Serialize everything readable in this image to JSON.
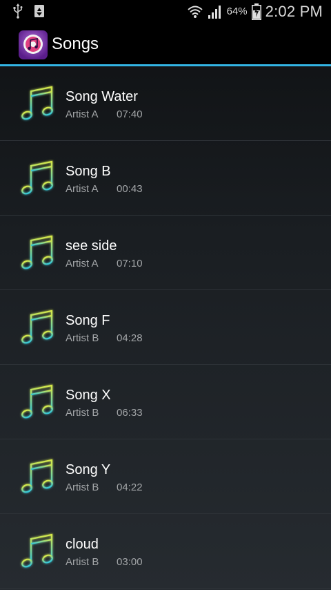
{
  "status_bar": {
    "icons_left": [
      "usb-icon",
      "recycle-icon"
    ],
    "battery_percent": "64%",
    "time": "2:02 PM"
  },
  "action_bar": {
    "title": "Songs",
    "icon": "music-app-icon"
  },
  "songs": [
    {
      "title": "Song Water",
      "artist": "Artist A",
      "duration": "07:40"
    },
    {
      "title": "Song B",
      "artist": "Artist A",
      "duration": "00:43"
    },
    {
      "title": "see side",
      "artist": "Artist A",
      "duration": "07:10"
    },
    {
      "title": "Song F",
      "artist": "Artist B",
      "duration": "04:28"
    },
    {
      "title": "Song X",
      "artist": "Artist B",
      "duration": "06:33"
    },
    {
      "title": "Song Y",
      "artist": "Artist B",
      "duration": "04:22"
    },
    {
      "title": "cloud",
      "artist": "Artist B",
      "duration": "03:00"
    }
  ],
  "colors": {
    "accent": "#33b5e5",
    "note_top": "#d6e84a",
    "note_bottom": "#34c6d8"
  }
}
